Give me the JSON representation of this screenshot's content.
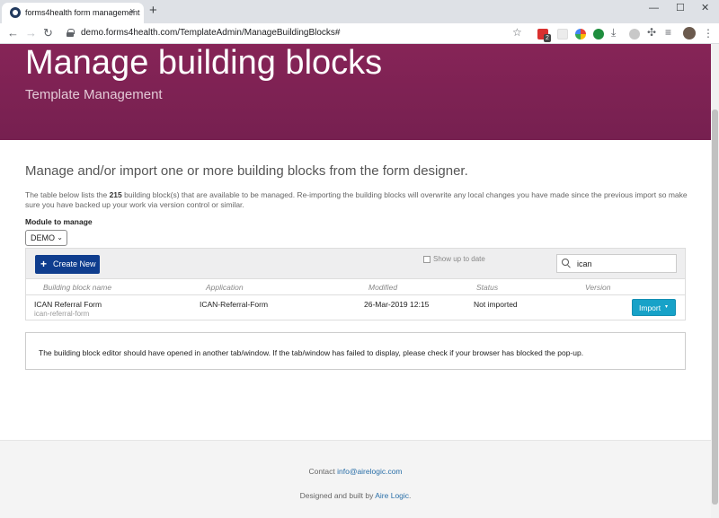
{
  "browser": {
    "tab_title": "forms4health form management",
    "tab_close": "×",
    "new_tab": "+",
    "url": "demo.forms4health.com/TemplateAdmin/ManageBuildingBlocks#",
    "win_minimize": "—",
    "win_restore": "☐",
    "win_close": "✕",
    "back": "←",
    "forward": "→",
    "reload": "↻",
    "star": "☆",
    "ext_badge": "2",
    "download": "⤓",
    "puzzle": "✣",
    "media": "≡",
    "menu": "⋮"
  },
  "hero": {
    "title": "Manage building blocks",
    "subtitle": "Template Management"
  },
  "intro": "Manage and/or import one or more building blocks from the form designer.",
  "description": {
    "before": "The table below lists the ",
    "count": "215",
    "after": " building block(s) that are available to be managed. Re-importing the building blocks will overwrite any local changes you have made since the previous import so make sure you have backed up your work via version control or similar."
  },
  "module": {
    "label": "Module to manage",
    "selected": "DEMO",
    "chevron": "⌄"
  },
  "grid": {
    "create_label": "Create New",
    "create_icon": "+",
    "checkbox_label": "Show up to date",
    "search_value": "ican",
    "columns": [
      "Building block name",
      "Application",
      "Modified",
      "Status",
      "Version"
    ],
    "rows": [
      {
        "name": "ICAN Referral Form",
        "slug": "ican-referral-form",
        "application": "ICAN-Referral-Form",
        "modified": "26-Mar-2019 12:15",
        "status": "Not imported",
        "action": "Import",
        "caret": "▾"
      }
    ]
  },
  "notice": "The building block editor should have opened in another tab/window. If the tab/window has failed to display, please check if your browser has blocked the pop-up.",
  "footer": {
    "contact_prefix": "Contact ",
    "contact_email": "info@airelogic.com",
    "built_prefix": "Designed and built by ",
    "built_link": "Aire Logic",
    "built_suffix": "."
  },
  "colors": {
    "brand": "#862457",
    "primary_button": "#0f3d8e",
    "import_button": "#17a2c8",
    "link": "#2a6fa8"
  }
}
